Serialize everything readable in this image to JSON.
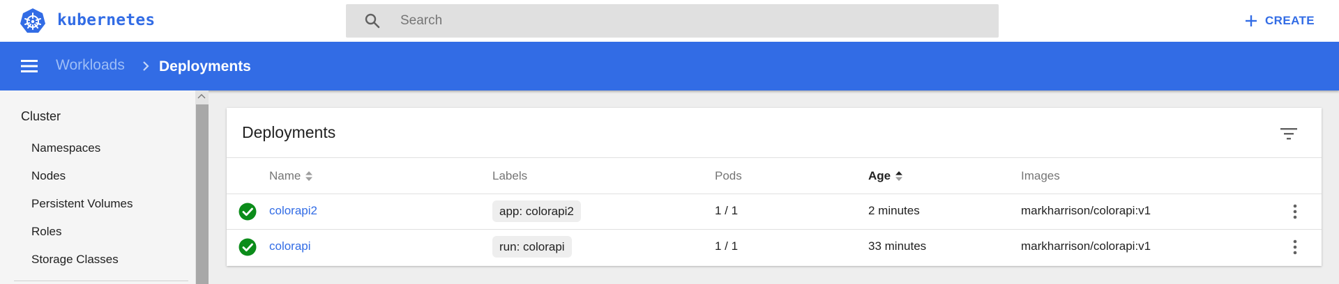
{
  "header": {
    "brand": "kubernetes",
    "search_placeholder": "Search",
    "create_label": "CREATE"
  },
  "breadcrumb": {
    "parent": "Workloads",
    "current": "Deployments"
  },
  "sidebar": {
    "section_title": "Cluster",
    "items": [
      "Namespaces",
      "Nodes",
      "Persistent Volumes",
      "Roles",
      "Storage Classes"
    ]
  },
  "card": {
    "title": "Deployments",
    "columns": {
      "name": "Name",
      "labels": "Labels",
      "pods": "Pods",
      "age": "Age",
      "images": "Images"
    },
    "rows": [
      {
        "status": "running",
        "name": "colorapi2",
        "label": "app: colorapi2",
        "pods": "1 / 1",
        "age": "2 minutes",
        "image": "markharrison/colorapi:v1"
      },
      {
        "status": "running",
        "name": "colorapi",
        "label": "run: colorapi",
        "pods": "1 / 1",
        "age": "33 minutes",
        "image": "markharrison/colorapi:v1"
      }
    ]
  },
  "colors": {
    "brand_blue": "#326ce5",
    "status_ok": "#0b8c1a"
  },
  "icons": {
    "logo": "kubernetes-helm-icon",
    "search": "search-icon",
    "create": "plus-icon",
    "menu": "hamburger-menu-icon",
    "breadcrumb_sep": "chevron-right-icon",
    "filter": "filter-icon",
    "status": "check-circle-icon",
    "row_actions": "more-vert-icon"
  }
}
